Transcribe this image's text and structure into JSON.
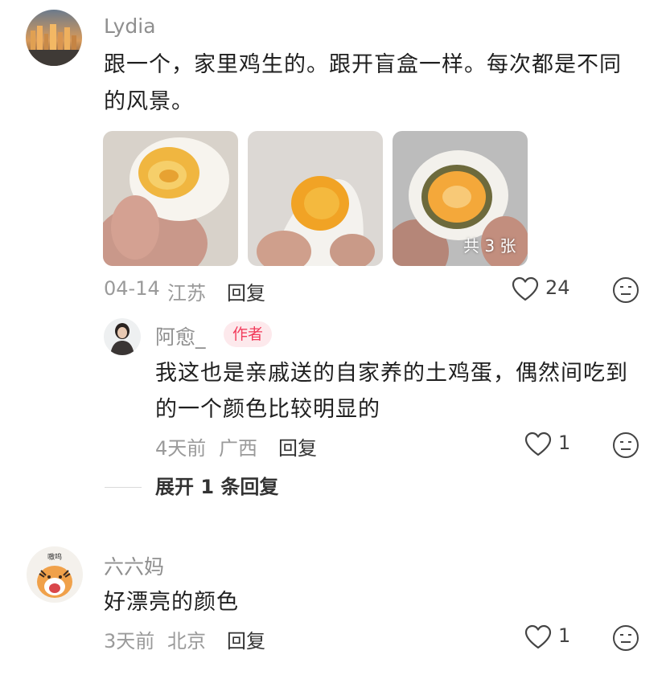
{
  "comments": [
    {
      "username": "Lydia",
      "text_line1": "跟一个，家里鸡生的。跟开盲盒一样。每次都是不同",
      "text_line2": "的风景。",
      "date": "04-14",
      "location": "江苏",
      "reply_label": "回复",
      "likes": "24",
      "image_count_badge": "共 3 张"
    },
    {
      "username": "阿愈_",
      "author_tag": "作者",
      "text_line1": "我这也是亲戚送的自家养的土鸡蛋，偶然间吃到",
      "text_line2": "的一个颜色比较明显的",
      "date": "4天前",
      "location": "广西",
      "reply_label": "回复",
      "likes": "1",
      "expand_label": "展开 1 条回复"
    },
    {
      "username": "六六妈",
      "avatar_text": "嗷呜",
      "text": "好漂亮的颜色",
      "date": "3天前",
      "location": "北京",
      "reply_label": "回复",
      "likes": "1"
    }
  ],
  "icons": {
    "like": "heart-outline-icon",
    "dislike": "neutral-face-icon"
  },
  "colors": {
    "author_tag_bg": "#fde9ec",
    "author_tag_text": "#f23b5b",
    "meta_text": "#9a9a9a"
  }
}
